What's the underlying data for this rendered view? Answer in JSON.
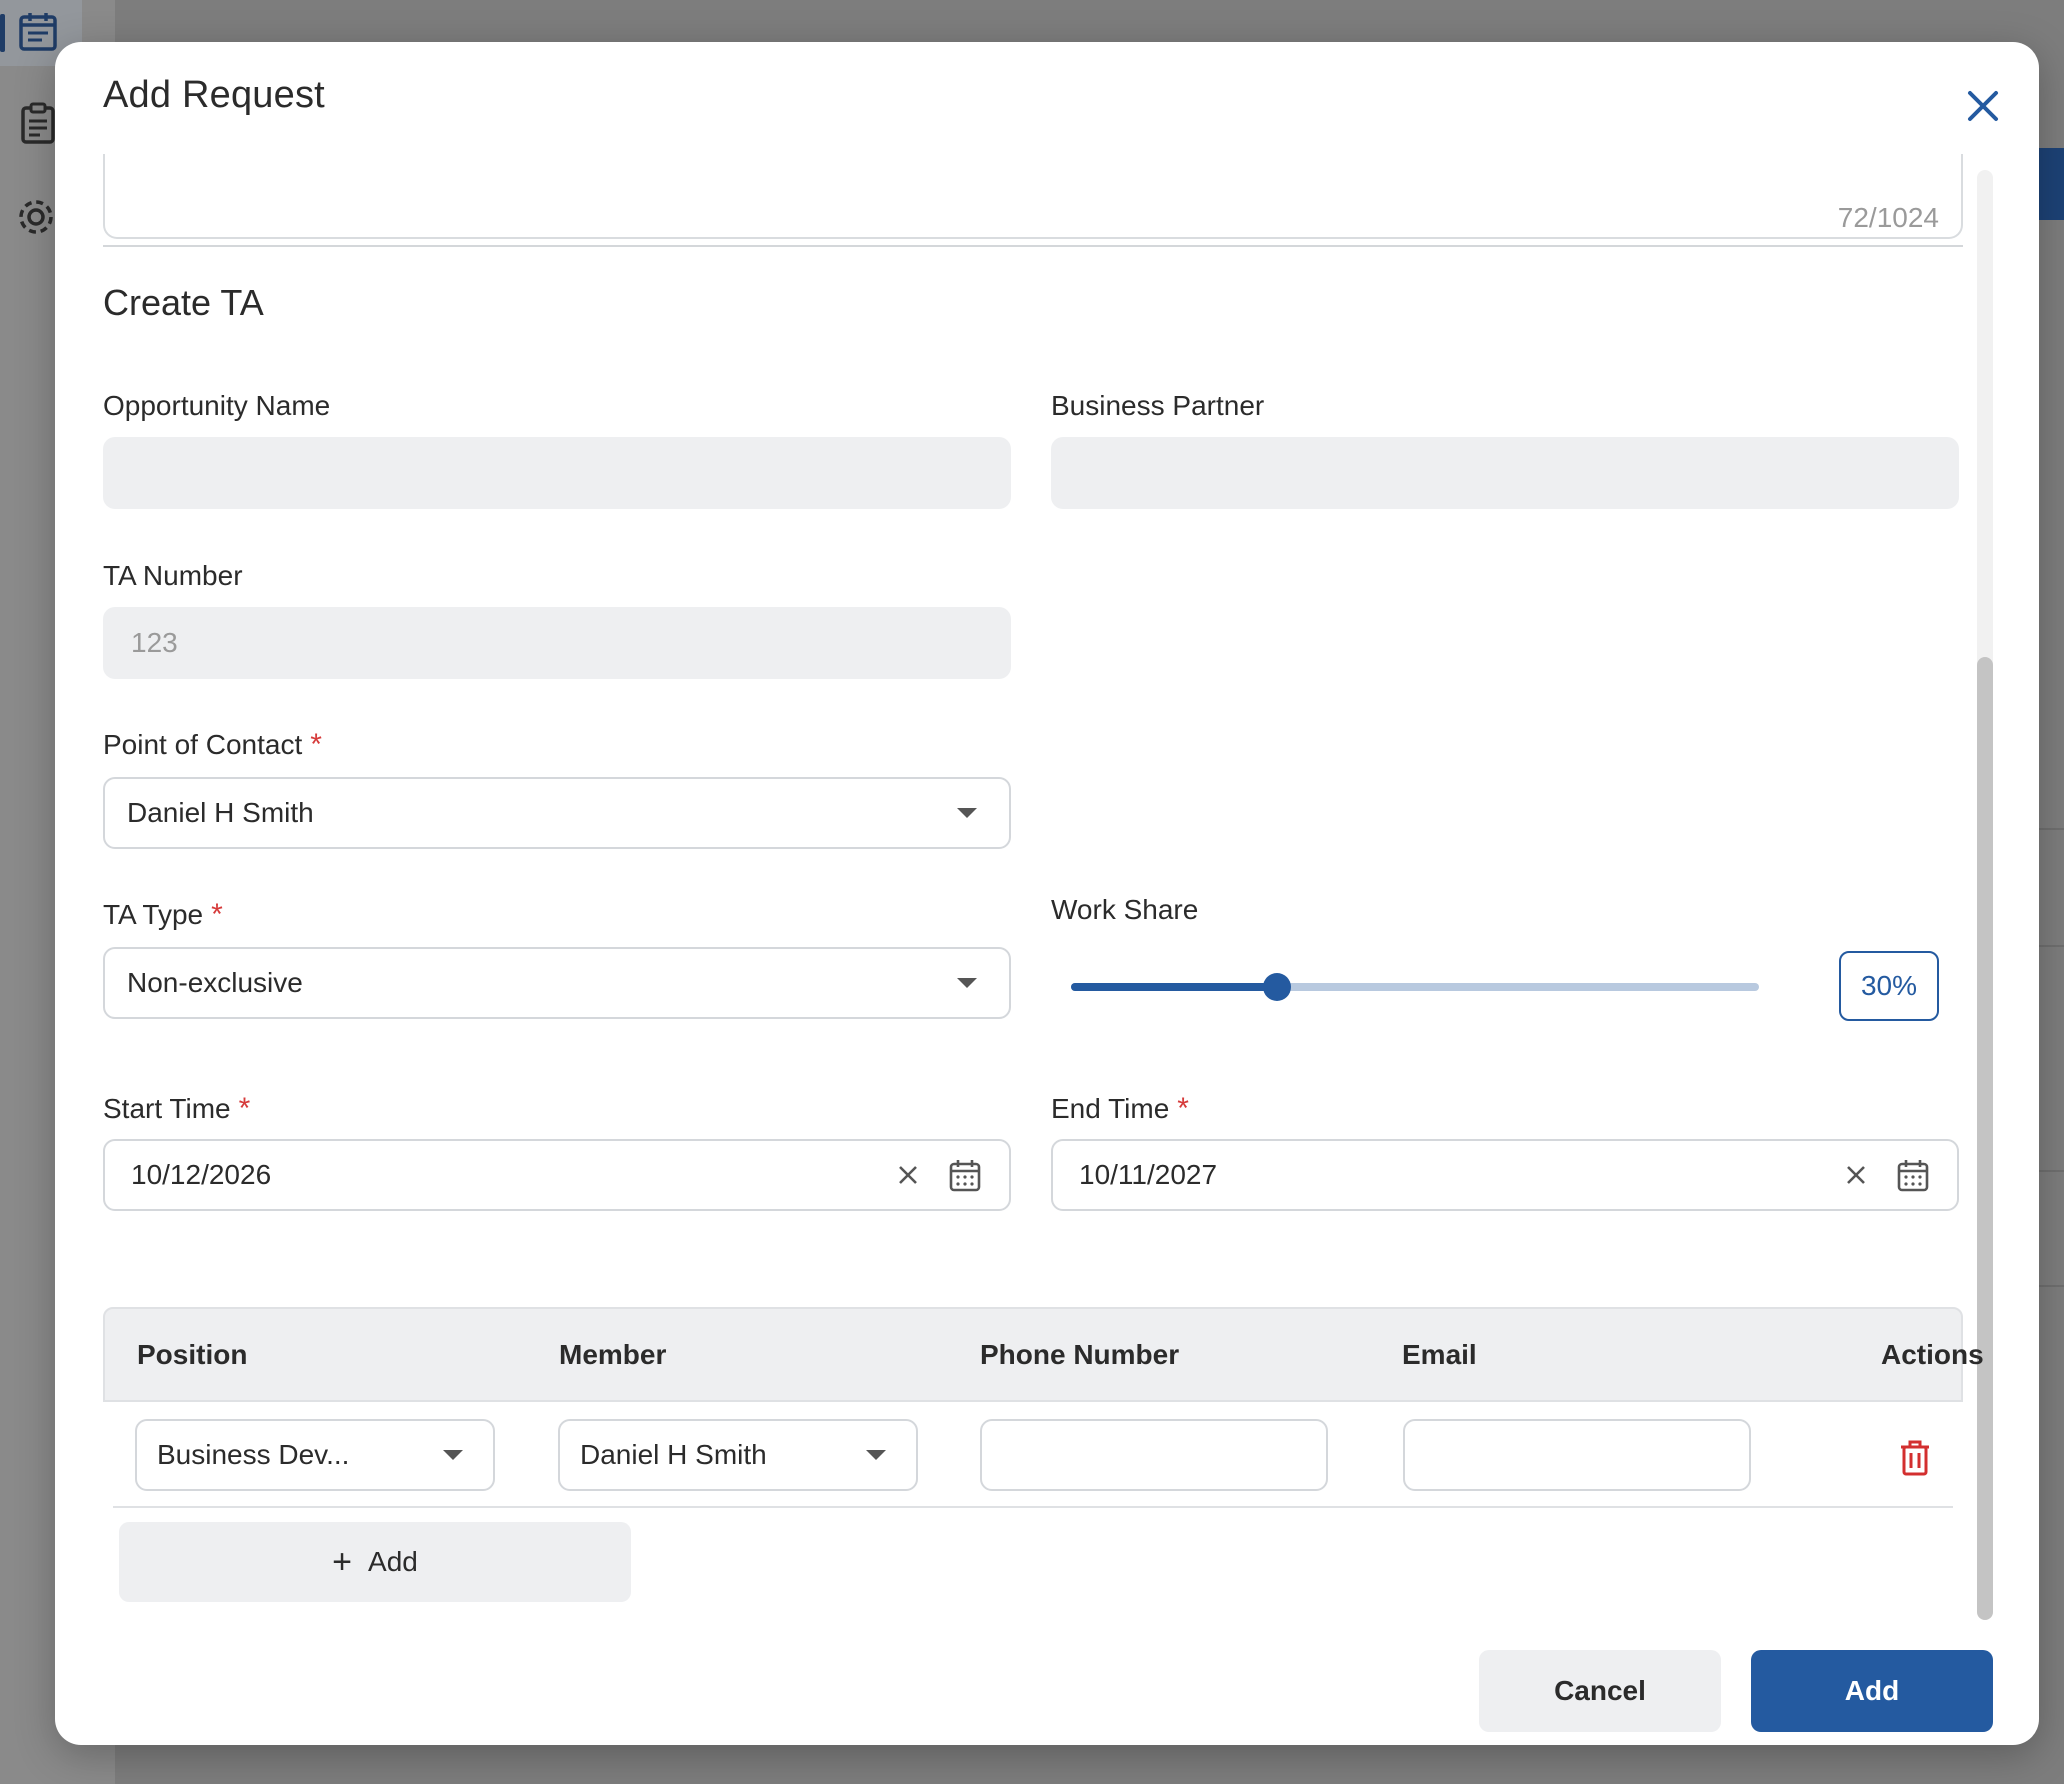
{
  "modal": {
    "title": "Add Request",
    "char_count": "72/1024",
    "section_title": "Create TA"
  },
  "form": {
    "opportunity_name": {
      "label": "Opportunity Name",
      "value": ""
    },
    "business_partner": {
      "label": "Business Partner",
      "value": ""
    },
    "ta_number": {
      "label": "TA Number",
      "placeholder": "123"
    },
    "point_of_contact": {
      "label": "Point of Contact",
      "required_mark": "*",
      "value": "Daniel H Smith"
    },
    "ta_type": {
      "label": "TA Type",
      "required_mark": "*",
      "value": "Non-exclusive"
    },
    "work_share": {
      "label": "Work Share",
      "percent": 30,
      "display": "30%"
    },
    "start_time": {
      "label": "Start Time",
      "required_mark": "*",
      "value": "10/12/2026"
    },
    "end_time": {
      "label": "End Time",
      "required_mark": "*",
      "value": "10/11/2027"
    }
  },
  "table": {
    "headers": [
      "Position",
      "Member",
      "Phone Number",
      "Email",
      "Actions"
    ],
    "rows": [
      {
        "position": "Business Dev...",
        "member": "Daniel H Smith",
        "phone": "",
        "email": ""
      }
    ],
    "add_label": "Add",
    "add_icon": "+"
  },
  "footer": {
    "cancel_label": "Cancel",
    "add_label": "Add"
  },
  "colors": {
    "primary": "#245aa0",
    "required": "#d63b3b",
    "delete": "#d32f2f"
  },
  "icons": {
    "close": "close-icon",
    "calendar": "calendar-icon",
    "clear": "clear-icon",
    "delete": "trash-icon",
    "caret": "chevron-down-icon",
    "plus": "plus-icon"
  }
}
